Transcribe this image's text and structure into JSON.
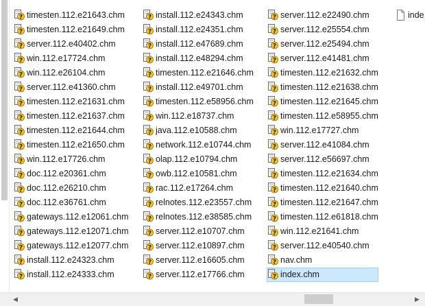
{
  "columns": [
    [
      "timesten.112.e21643.chm",
      "timesten.112.e21649.chm",
      "server.112.e40402.chm",
      "win.112.e17724.chm",
      "win.112.e26104.chm",
      "server.112.e41360.chm",
      "timesten.112.e21631.chm",
      "timesten.112.e21637.chm",
      "timesten.112.e21644.chm",
      "timesten.112.e21650.chm",
      "win.112.e17726.chm",
      "doc.112.e20361.chm",
      "doc.112.e26210.chm",
      "doc.112.e36761.chm",
      "gateways.112.e12061.chm",
      "gateways.112.e12071.chm",
      "gateways.112.e12077.chm",
      "install.112.e24323.chm",
      "install.112.e24333.chm"
    ],
    [
      "install.112.e24343.chm",
      "install.112.e24351.chm",
      "install.112.e47689.chm",
      "install.112.e48294.chm",
      "timesten.112.e21646.chm",
      "install.112.e49701.chm",
      "timesten.112.e58956.chm",
      "win.112.e18737.chm",
      "java.112.e10588.chm",
      "network.112.e10744.chm",
      "olap.112.e10794.chm",
      "owb.112.e10581.chm",
      "rac.112.e17264.chm",
      "relnotes.112.e23557.chm",
      "relnotes.112.e38585.chm",
      "server.112.e10707.chm",
      "server.112.e10897.chm",
      "server.112.e16605.chm",
      "server.112.e17766.chm"
    ],
    [
      "server.112.e22490.chm",
      "server.112.e25554.chm",
      "server.112.e25494.chm",
      "server.112.e41481.chm",
      "timesten.112.e21632.chm",
      "timesten.112.e21638.chm",
      "timesten.112.e21645.chm",
      "timesten.112.e58955.chm",
      "win.112.e17727.chm",
      "server.112.e41084.chm",
      "server.112.e56697.chm",
      "timesten.112.e21634.chm",
      "timesten.112.e21640.chm",
      "timesten.112.e21647.chm",
      "timesten.112.e61818.chm",
      "win.112.e21641.chm",
      "server.112.e40540.chm",
      "nav.chm",
      "index.chm"
    ],
    [
      "inde"
    ]
  ],
  "selected_item": "index.chm",
  "icons": {
    "chm": "chm-help-file-icon",
    "generic": "generic-file-icon"
  },
  "colors": {
    "selection_bg": "#cce8ff",
    "selection_border": "#99d1ff"
  }
}
